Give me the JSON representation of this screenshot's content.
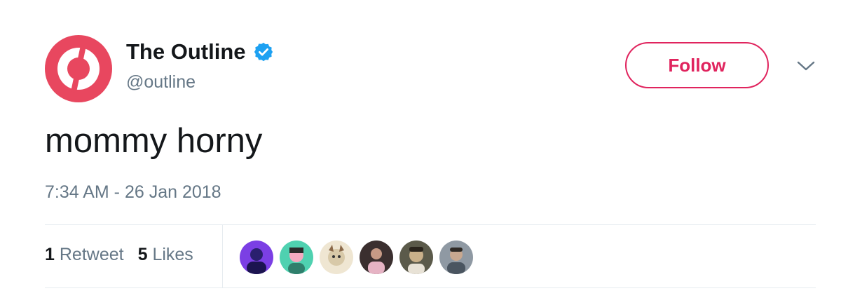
{
  "tweet": {
    "author": {
      "display_name": "The Outline",
      "handle": "@outline",
      "verified": true,
      "avatar_icon": "the-outline-logo-icon",
      "avatar_color": "#e8475f"
    },
    "follow_label": "Follow",
    "text": "mommy horny",
    "timestamp": "7:34 AM - 26 Jan 2018",
    "stats": {
      "retweets_count": "1",
      "retweets_label": "Retweet",
      "likes_count": "5",
      "likes_label": "Likes"
    },
    "liker_avatars": [
      {
        "icon": "liker-avatar-1",
        "colors": [
          "#7b3fe4",
          "#2a1f6e"
        ]
      },
      {
        "icon": "liker-avatar-2",
        "colors": [
          "#4fd1b0",
          "#f4a9c0"
        ]
      },
      {
        "icon": "liker-avatar-3",
        "colors": [
          "#d8c9a8",
          "#8b6a4a"
        ]
      },
      {
        "icon": "liker-avatar-4",
        "colors": [
          "#3b2f2f",
          "#c79a86"
        ]
      },
      {
        "icon": "liker-avatar-5",
        "colors": [
          "#5b5a4a",
          "#c9b08a"
        ]
      },
      {
        "icon": "liker-avatar-6",
        "colors": [
          "#8f99a3",
          "#4a5560"
        ]
      }
    ]
  },
  "colors": {
    "accent": "#e0245e",
    "verified_blue": "#1da1f2",
    "text_primary": "#14171a",
    "text_secondary": "#657786",
    "divider": "#e6ecf0"
  }
}
